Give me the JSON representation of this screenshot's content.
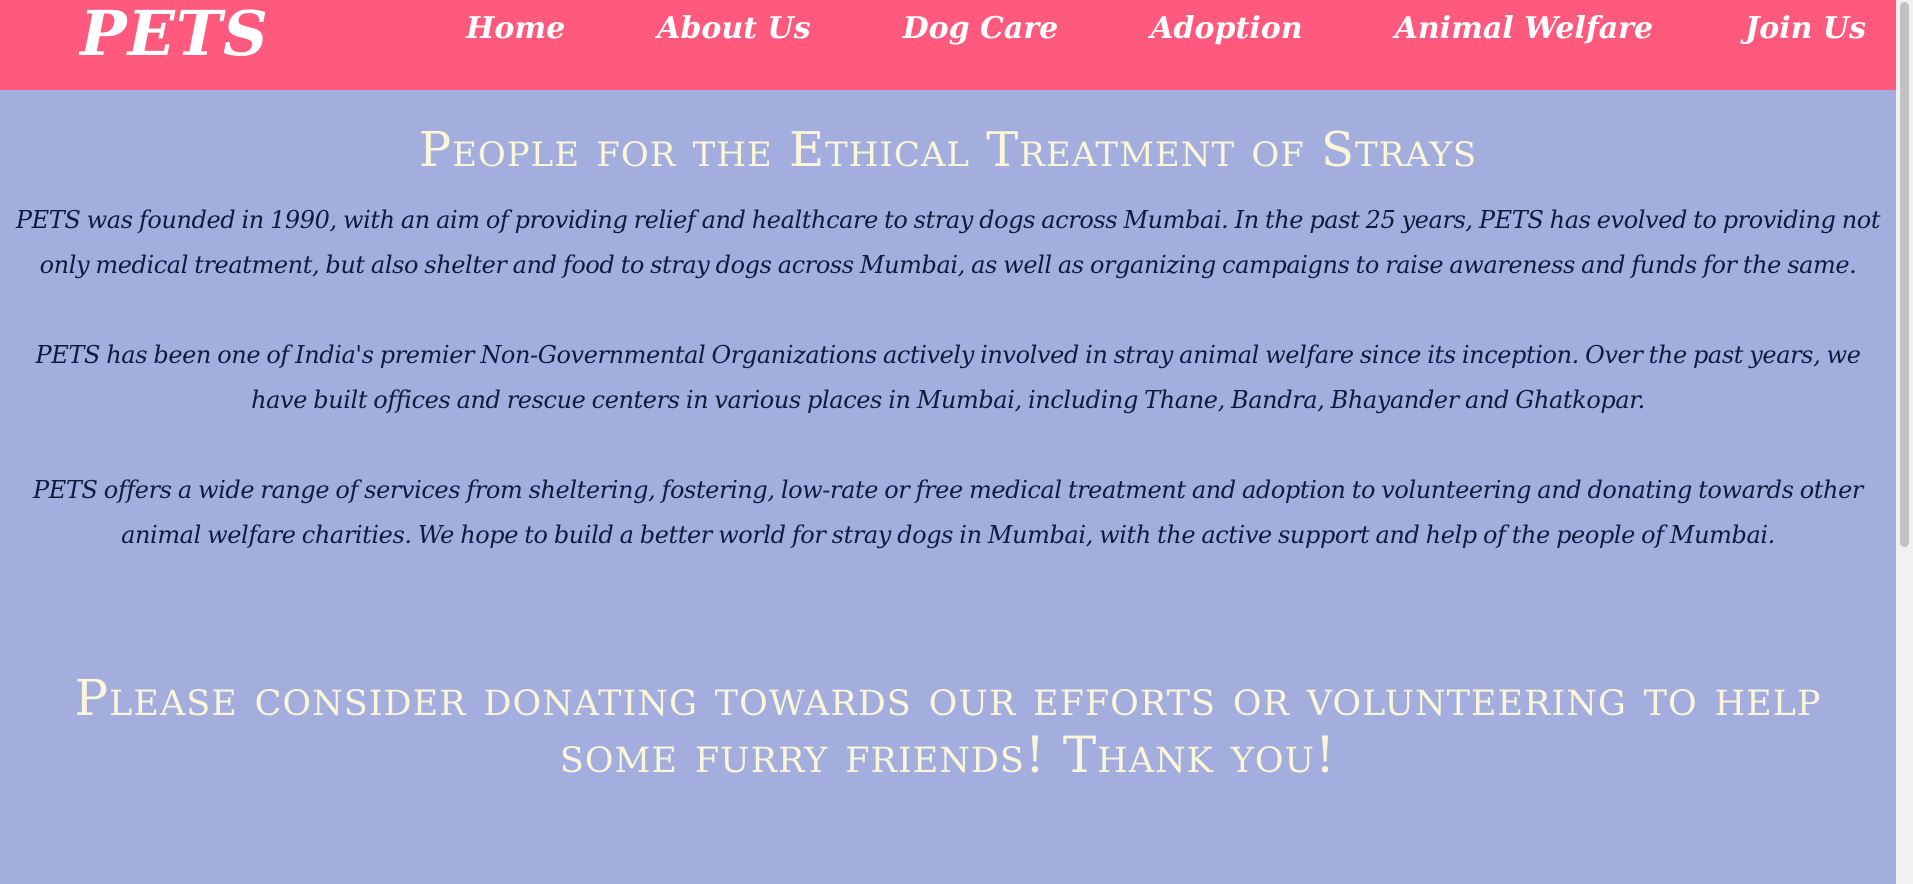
{
  "brand": {
    "logo": "PETS",
    "colors": {
      "navbar": "#ff5a7d",
      "background": "#a3aedf",
      "heading_text": "#fbf6d8",
      "body_text": "#0d1c3d"
    }
  },
  "nav": {
    "items": [
      {
        "label": "Home"
      },
      {
        "label": "About Us"
      },
      {
        "label": "Dog Care"
      },
      {
        "label": "Adoption"
      },
      {
        "label": "Animal Welfare"
      },
      {
        "label": "Join Us"
      }
    ]
  },
  "main": {
    "title": "People for the Ethical Treatment of Strays",
    "paragraphs": [
      "PETS was founded in 1990, with an aim of providing relief and healthcare to stray dogs across Mumbai. In the past 25 years, PETS has evolved to providing not only medical treatment, but also shelter and food to stray dogs across Mumbai, as well as organizing campaigns to raise awareness and funds for the same.",
      "PETS has been one of India's premier Non-Governmental Organizations actively involved in stray animal welfare since its inception. Over the past years, we have built offices and rescue centers in various places in Mumbai, including Thane, Bandra, Bhayander and Ghatkopar.",
      "PETS offers a wide range of services from sheltering, fostering, low-rate or free medical treatment and adoption to volunteering and donating towards other animal welfare charities. We hope to build a better world for stray dogs in Mumbai, with the active support and help of the people of Mumbai."
    ],
    "cta": "Please consider donating towards our efforts or volunteering to help some furry friends! Thank you!"
  }
}
